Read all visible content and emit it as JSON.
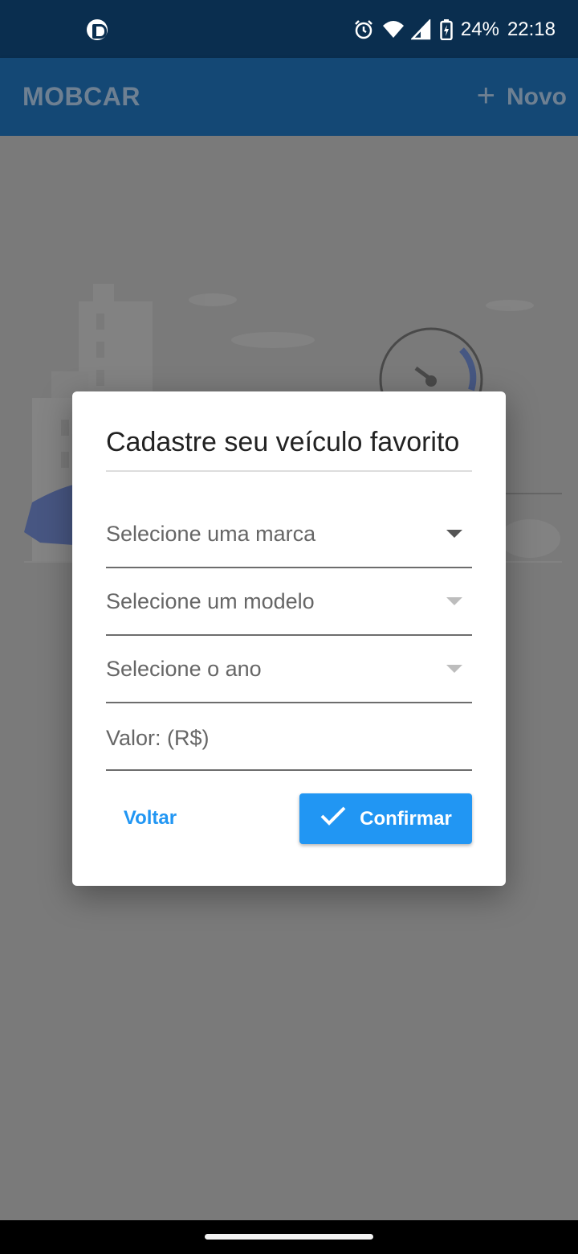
{
  "status_bar": {
    "battery_percent": "24%",
    "time": "22:18",
    "icons": [
      "app-notification-icon",
      "alarm-icon",
      "wifi-icon",
      "signal-icon",
      "battery-charging-icon"
    ]
  },
  "app_bar": {
    "title": "MOBCAR",
    "new_button_label": "Novo",
    "new_button_icon": "plus-icon"
  },
  "dialog": {
    "title": "Cadastre seu veículo favorito",
    "fields": {
      "brand": {
        "placeholder": "Selecione uma marca",
        "icon": "dropdown-arrow-icon"
      },
      "model": {
        "placeholder": "Selecione um modelo",
        "icon": "dropdown-arrow-icon"
      },
      "year": {
        "placeholder": "Selecione o ano",
        "icon": "dropdown-arrow-icon"
      },
      "value": {
        "placeholder": "Valor: (R$)",
        "value": ""
      }
    },
    "back_label": "Voltar",
    "confirm_label": "Confirmar",
    "confirm_icon": "check-icon"
  },
  "colors": {
    "status_bar_bg": "#0a2e4f",
    "app_bar_bg": "#144875",
    "accent": "#2196f3",
    "scrim": "#7a7a7a"
  }
}
